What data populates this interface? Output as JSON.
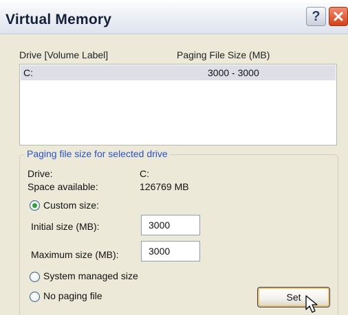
{
  "window": {
    "title": "Virtual Memory",
    "help_icon": "question-mark-icon",
    "close_icon": "close-x-icon"
  },
  "list": {
    "columns": [
      "Drive  [Volume Label]",
      "Paging File Size (MB)"
    ],
    "rows": [
      {
        "drive": "C:",
        "size": "3000 - 3000",
        "selected": true
      }
    ]
  },
  "group": {
    "legend": "Paging file size for selected drive",
    "drive_label": "Drive:",
    "drive_value": "C:",
    "space_label": "Space available:",
    "space_value": "126769 MB",
    "options": {
      "custom": {
        "label": "Custom size:",
        "selected": true
      },
      "system": {
        "label": "System managed size",
        "selected": false
      },
      "none": {
        "label": "No paging file",
        "selected": false
      }
    },
    "initial_label": "Initial size (MB):",
    "initial_value": "3000",
    "maximum_label": "Maximum size (MB):",
    "maximum_value": "3000",
    "set_button": "Set"
  },
  "colors": {
    "legend_text": "#2a52c8",
    "radio_selected": "#2fa33a",
    "close_button": "#d34218"
  }
}
